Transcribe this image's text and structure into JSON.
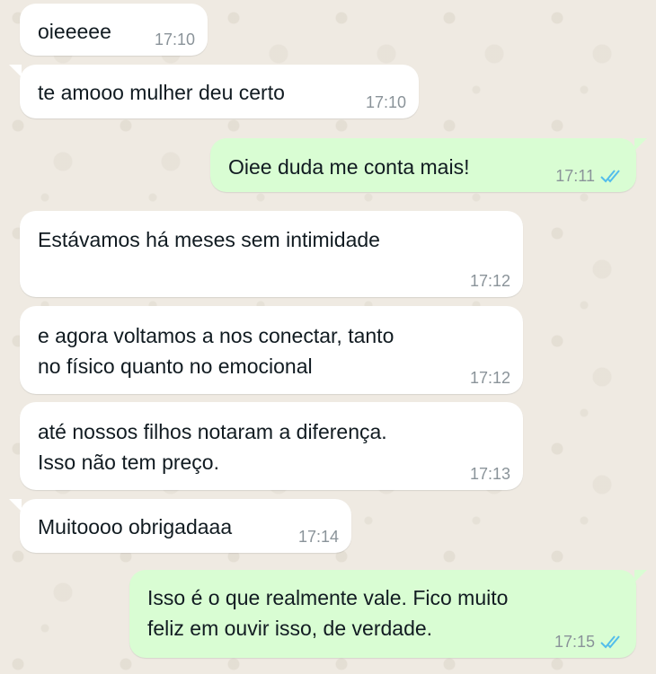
{
  "colors": {
    "wallpaper": "#efeae2",
    "incoming_bubble": "#ffffff",
    "outgoing_bubble": "#d9fdd3",
    "read_receipt": "#53bdeb",
    "timestamp": "#8a9399"
  },
  "messages": [
    {
      "direction": "incoming",
      "text": "oieeeee",
      "time": "17:10"
    },
    {
      "direction": "incoming",
      "text": "te amooo mulher deu certo",
      "time": "17:10"
    },
    {
      "direction": "outgoing",
      "text": "Oiee duda me conta mais!",
      "time": "17:11",
      "status_icon": "double-check-read-icon"
    },
    {
      "direction": "incoming",
      "text": "Estávamos há meses sem intimidade",
      "time": "17:12"
    },
    {
      "direction": "incoming",
      "text": "e agora voltamos a nos conectar, tanto\nno físico quanto no emocional",
      "time": "17:12"
    },
    {
      "direction": "incoming",
      "text": "até nossos filhos notaram a diferença.\nIsso não tem preço.",
      "time": "17:13"
    },
    {
      "direction": "incoming",
      "text": "Muitoooo obrigadaaa",
      "time": "17:14"
    },
    {
      "direction": "outgoing",
      "text": "Isso é o que realmente vale. Fico muito\nfeliz em ouvir isso, de verdade.",
      "time": "17:15",
      "status_icon": "double-check-read-icon"
    }
  ]
}
